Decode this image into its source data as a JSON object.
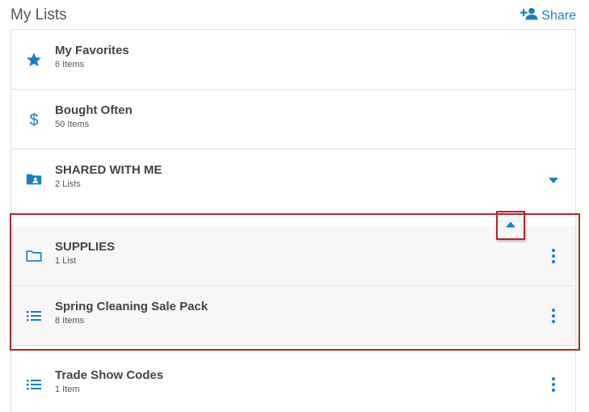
{
  "header": {
    "title": "My Lists",
    "share_label": "Share"
  },
  "colors": {
    "accent": "#1a7fc1",
    "highlight": "#b5252b"
  },
  "lists": [
    {
      "name": "My Favorites",
      "count": "6 Items",
      "icon": "star-icon"
    },
    {
      "name": "Bought Often",
      "count": "50 Items",
      "icon": "dollar-icon"
    },
    {
      "name": "SHARED WITH ME",
      "count": "2 Lists",
      "icon": "shared-folder-icon",
      "expanded": false
    },
    {
      "name": "SUPPLIES",
      "count": "1 List",
      "icon": "folder-icon",
      "expanded": true
    },
    {
      "name": "Spring Cleaning Sale Pack",
      "count": "8 Items",
      "icon": "list-icon"
    },
    {
      "name": "Trade Show Codes",
      "count": "1 Item",
      "icon": "list-icon"
    }
  ]
}
